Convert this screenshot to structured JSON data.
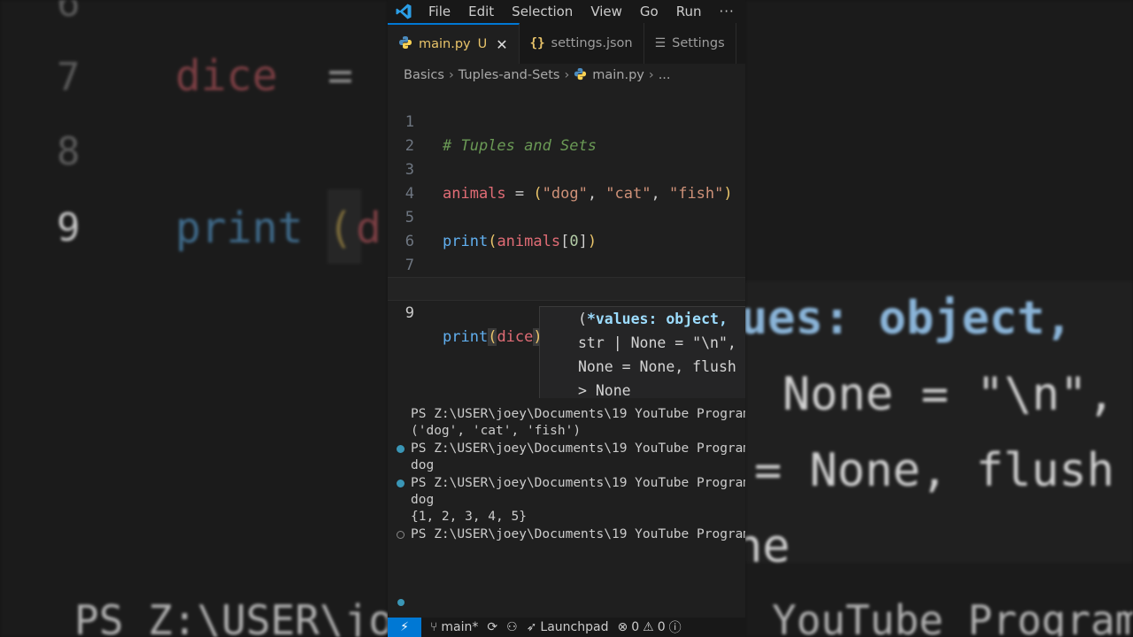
{
  "menu": [
    "File",
    "Edit",
    "Selection",
    "View",
    "Go",
    "Run",
    "···"
  ],
  "tabs": [
    {
      "label": "main.py",
      "status": "U",
      "close": "✕",
      "active": true
    },
    {
      "label": "settings.json",
      "active": false
    },
    {
      "label": "Settings",
      "active": false
    }
  ],
  "breadcrumb": [
    "Basics",
    "Tuples-and-Sets",
    "main.py",
    "..."
  ],
  "editor": {
    "line_numbers": [
      "1",
      "2",
      "3",
      "4",
      "5",
      "6",
      "7",
      "8",
      "9"
    ],
    "line1": "# Tuples and Sets",
    "line3": {
      "var": "animals",
      "op": " = ",
      "open": "(",
      "s1": "\"dog\"",
      "s2": "\"cat\"",
      "s3": "\"fish\"",
      "close": ")"
    },
    "line5": {
      "fn": "print",
      "open": "(",
      "arg": "animals",
      "idx_open": "[",
      "idx": "0",
      "idx_close": "]",
      "close": ")"
    },
    "line7": {
      "var": "dice",
      "op": " = ",
      "open": "{",
      "nums": [
        "1",
        "2",
        "3",
        "4",
        "5"
      ],
      "close": "}"
    },
    "line9": {
      "fn": "print",
      "open": "(",
      "arg": "dice",
      "close": ")"
    }
  },
  "hover": {
    "line1_open": "(",
    "line1_bold": "*values: object,",
    "line2": "str | None = \"\\n\",",
    "line3": "None = None, flush",
    "line4": "> None"
  },
  "terminal": {
    "prompt": "PS Z:\\USER\\joey\\Documents\\19 YouTube Program",
    "out1": "('dog', 'cat', 'fish')",
    "out2": "dog",
    "out3": "dog",
    "out4": "{1, 2, 3, 4, 5}"
  },
  "statusbar": {
    "branch": "main*",
    "launchpad": "Launchpad",
    "errors": "0",
    "warnings": "0"
  },
  "background": {
    "left_line_numbers": [
      "6",
      "7",
      "8",
      "9"
    ],
    "left_code_dice": "dice",
    "left_code_eq": "=",
    "left_code_print": "print",
    "left_code_paren": "(",
    "left_code_arg": "d",
    "right_hover1": "ues: object,",
    "right_hover2": "None = \"\\n\",",
    "right_hover3": "= None, flush",
    "right_hover4": "ne",
    "bottom_left": "PS Z:\\USER\\jo",
    "bottom_right": "YouTube Program"
  },
  "colors": {
    "accent": "#0078d4",
    "tab_modified": "#e9c46a",
    "variable": "#e06c75",
    "function": "#61afef",
    "string": "#ce9178"
  }
}
